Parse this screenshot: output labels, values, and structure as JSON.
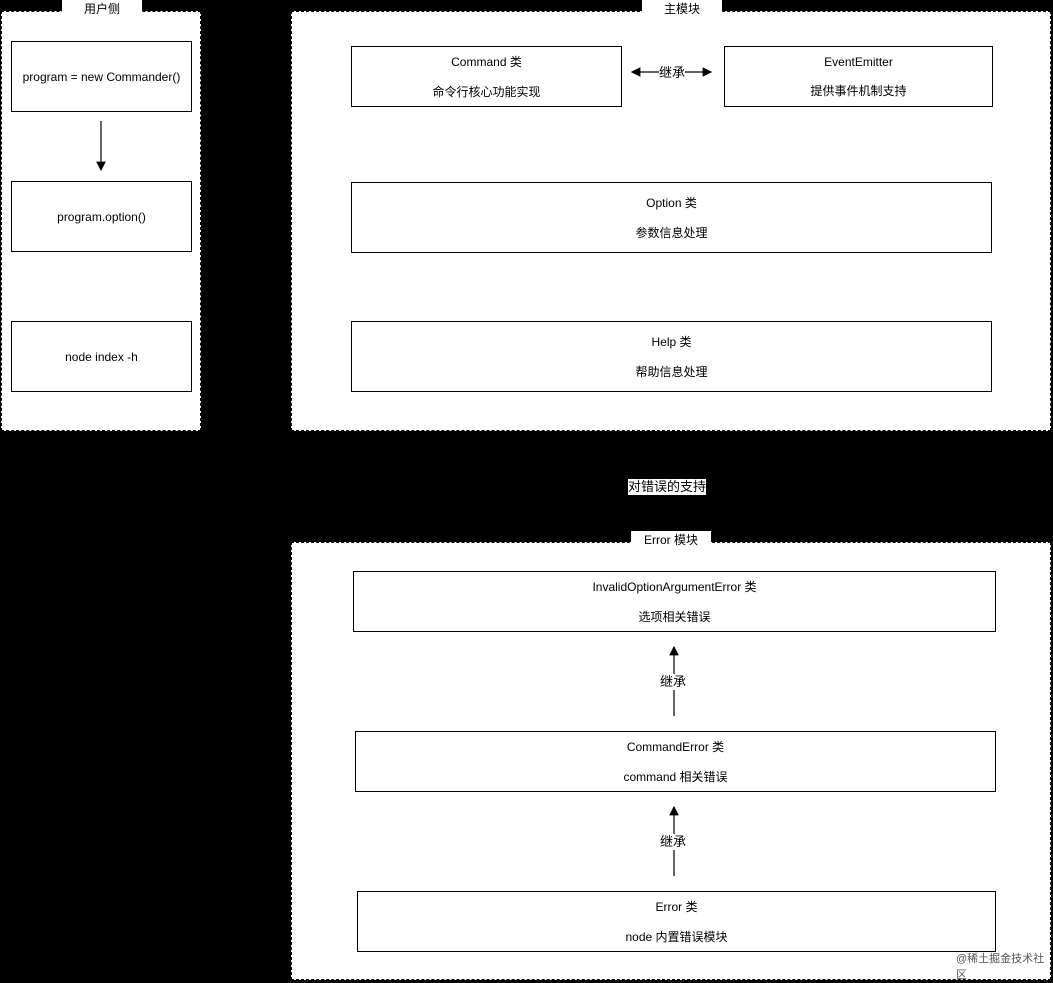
{
  "groups": {
    "user": {
      "label": "用户侧"
    },
    "main": {
      "label": "主模块"
    },
    "error": {
      "label": "Error 模块"
    }
  },
  "user_steps": [
    {
      "text": "program = new Commander()"
    },
    {
      "text": "program.option()"
    },
    {
      "text": "node index -h"
    }
  ],
  "main_boxes": {
    "command": {
      "title": "Command 类",
      "desc": "命令行核心功能实现"
    },
    "event_emitter": {
      "title": "EventEmitter",
      "desc": "提供事件机制支持"
    },
    "option": {
      "title": "Option 类",
      "desc": "参数信息处理"
    },
    "help": {
      "title": "Help 类",
      "desc": "帮助信息处理"
    }
  },
  "inherit_label": "继承",
  "error_support_label": "对错误的支持",
  "error_boxes": {
    "invalid_option": {
      "title": "InvalidOptionArgumentError 类",
      "desc": "选项相关错误"
    },
    "command_error": {
      "title": "CommandError 类",
      "desc": "command 相关错误"
    },
    "error": {
      "title": "Error 类",
      "desc": "node 内置错误模块"
    }
  },
  "watermark": "@稀土掘金技术社区"
}
